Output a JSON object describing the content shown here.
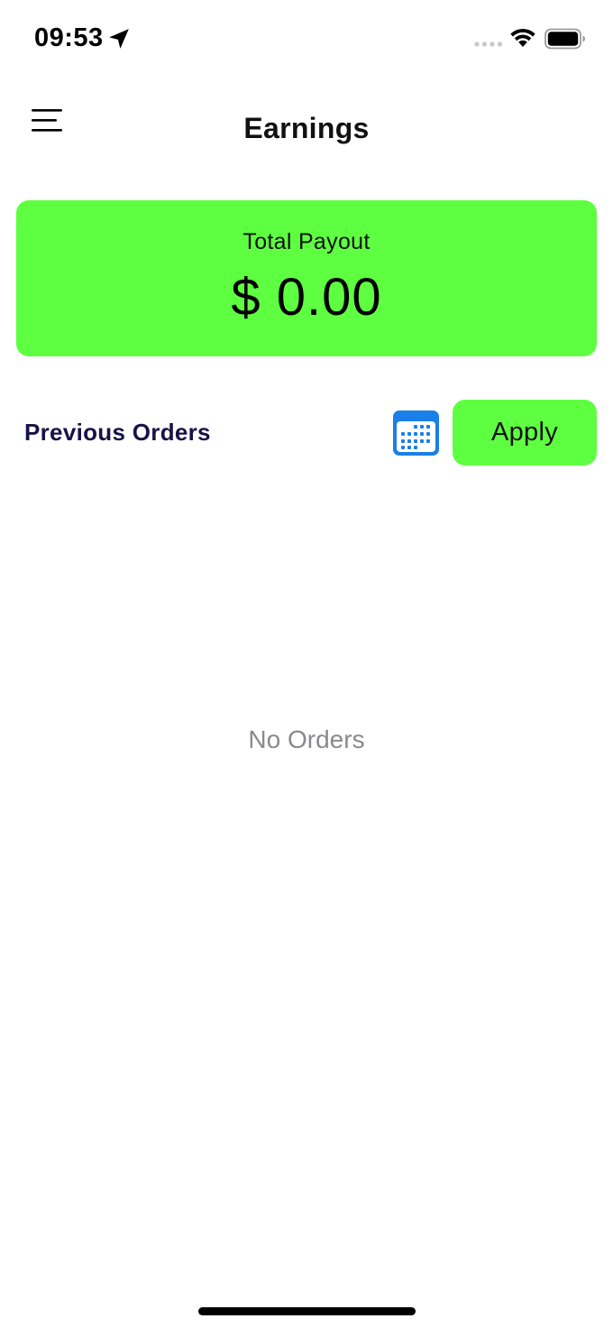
{
  "status_bar": {
    "time": "09:53",
    "location_icon": "location-arrow-icon",
    "signal_icon": "cellular-signal-icon",
    "wifi_icon": "wifi-icon",
    "battery_icon": "battery-icon"
  },
  "header": {
    "title": "Earnings",
    "menu_icon": "hamburger-menu-icon"
  },
  "payout": {
    "label": "Total Payout",
    "amount": "$ 0.00"
  },
  "orders": {
    "heading": "Previous Orders",
    "calendar_icon": "calendar-icon",
    "apply_label": "Apply",
    "empty_text": "No Orders"
  },
  "colors": {
    "accent_green": "#5eff41",
    "heading_navy": "#171347",
    "calendar_blue": "#1a7fe8",
    "empty_gray": "#8a8a8e"
  }
}
